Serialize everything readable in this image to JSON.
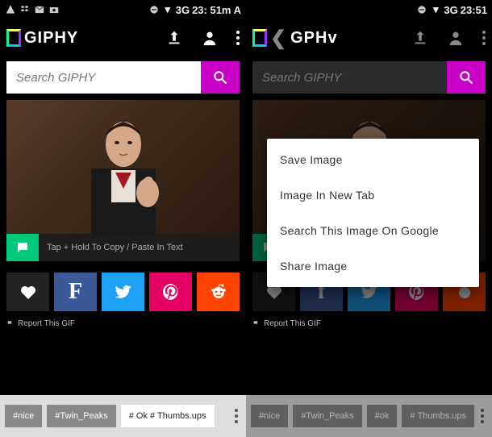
{
  "status": {
    "network": "3G",
    "time_left": "23: 51m A",
    "time_right": "23:51"
  },
  "brand": {
    "name_left": "GIPHY",
    "name_right": "GPHv"
  },
  "search": {
    "placeholder": "Search GIPHY"
  },
  "gif": {
    "hint": "Tap + Hold To Copy / Paste In Text"
  },
  "report": {
    "label": "Report This GIF"
  },
  "tags_left": [
    "#nice",
    "#Twin_Peaks",
    "# Ok # Thumbs.ups"
  ],
  "tags_right": [
    "#nice",
    "#Twin_Peaks",
    "#ok",
    "# Thumbs.ups"
  ],
  "context_menu": {
    "items": [
      "Save Image",
      "Image In New Tab",
      "Search This Image On Google",
      "Share Image"
    ]
  },
  "colors": {
    "accent": "#c800c8",
    "hint_green": "#00c97b",
    "facebook": "#3b5998",
    "twitter": "#1da1f2",
    "pinterest": "#e60064",
    "reddit": "#ff4500"
  }
}
